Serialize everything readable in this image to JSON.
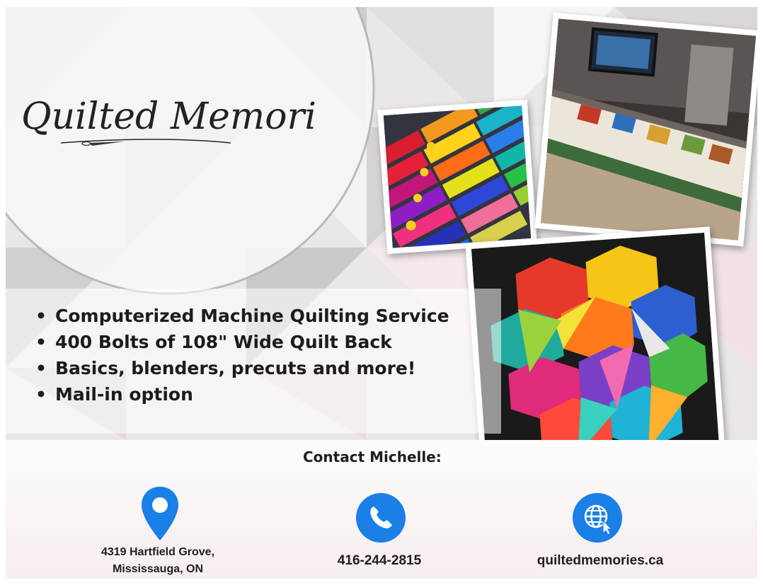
{
  "brand": {
    "logo_text": "Quilted Memories"
  },
  "services": [
    "Computerized Machine Quilting Service",
    "400 Bolts of 108\" Wide Quilt Back",
    "Basics, blenders, precuts and more!",
    "Mail-in option"
  ],
  "contact": {
    "title": "Contact Michelle:",
    "address_line1": "4319 Hartfield Grove,",
    "address_line2": "Mississauga, ON",
    "phone": "416-244-2815",
    "website": "quiltedmemories.ca"
  },
  "icons": {
    "address": "map-pin-icon",
    "phone": "phone-icon",
    "website": "globe-icon"
  },
  "colors": {
    "icon_blue": "#1a7fe6",
    "text": "#1e1e1e"
  }
}
